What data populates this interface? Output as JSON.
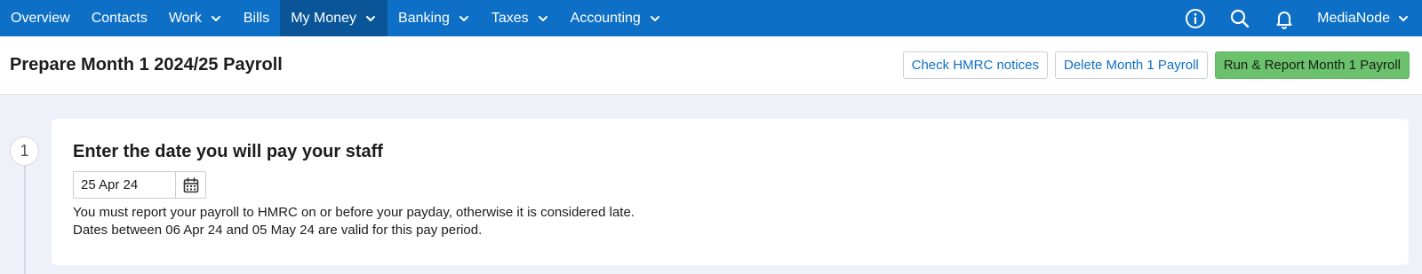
{
  "nav": {
    "items": [
      {
        "label": "Overview",
        "dropdown": false
      },
      {
        "label": "Contacts",
        "dropdown": false
      },
      {
        "label": "Work",
        "dropdown": true
      },
      {
        "label": "Bills",
        "dropdown": false
      },
      {
        "label": "My Money",
        "dropdown": true,
        "active": true
      },
      {
        "label": "Banking",
        "dropdown": true
      },
      {
        "label": "Taxes",
        "dropdown": true
      },
      {
        "label": "Accounting",
        "dropdown": true
      }
    ],
    "icons": [
      "info-icon",
      "search-icon",
      "bell-icon"
    ],
    "user": "MediaNode"
  },
  "header": {
    "title": "Prepare Month 1 2024/25 Payroll",
    "buttons": {
      "check": "Check HMRC notices",
      "delete": "Delete Month 1 Payroll",
      "run": "Run & Report Month 1 Payroll"
    }
  },
  "step": {
    "number": "1",
    "title": "Enter the date you will pay your staff",
    "date_value": "25 Apr 24",
    "help_line1": "You must report your payroll to HMRC on or before your payday, otherwise it is considered late.",
    "help_line2": "Dates between 06 Apr 24 and 05 May 24 are valid for this pay period."
  },
  "colors": {
    "nav_bg": "#0d6fc5",
    "nav_active": "#0a5598",
    "primary_button": "#6cc16d",
    "link": "#0d6fc5",
    "page_bg": "#eef1f8"
  }
}
